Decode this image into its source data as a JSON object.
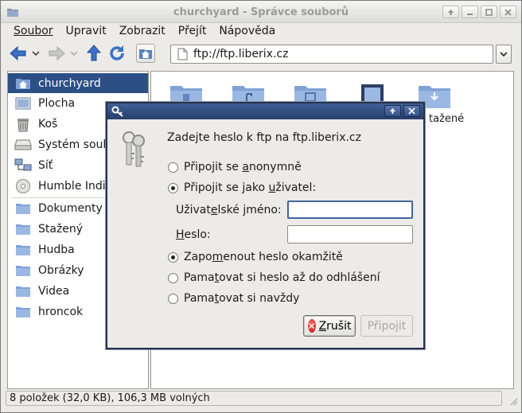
{
  "window": {
    "title": "churchyard - Správce souborů"
  },
  "menubar": {
    "items": [
      {
        "label": "Soubor"
      },
      {
        "label": "Upravit"
      },
      {
        "label": "Zobrazit"
      },
      {
        "label": "Přejít"
      },
      {
        "label": "Nápověda"
      }
    ]
  },
  "toolbar": {
    "address": "ftp://ftp.liberix.cz"
  },
  "sidebar": {
    "items": [
      {
        "label": "churchyard",
        "icon": "home-folder-icon",
        "selected": true
      },
      {
        "label": "Plocha",
        "icon": "desktop-icon"
      },
      {
        "label": "Koš",
        "icon": "trash-icon"
      },
      {
        "label": "Systém soubo",
        "icon": "harddisk-icon"
      },
      {
        "label": "Síť",
        "icon": "network-icon"
      },
      {
        "label": "Humble Indie",
        "icon": "optical-disc-icon"
      },
      {
        "label": "Dokumenty",
        "icon": "folder-icon"
      },
      {
        "label": "Stažený",
        "icon": "folder-icon"
      },
      {
        "label": "Hudba",
        "icon": "folder-icon"
      },
      {
        "label": "Obrázky",
        "icon": "folder-icon"
      },
      {
        "label": "Videa",
        "icon": "folder-icon"
      },
      {
        "label": "hroncok",
        "icon": "folder-icon"
      }
    ]
  },
  "mainview": {
    "visible_label": "tažené"
  },
  "statusbar": {
    "text": "8 položek (32,0 KB), 106,3 MB volných"
  },
  "dialog": {
    "prompt": "Zadejte heslo k ftp na ftp.liberix.cz",
    "opt_anonymous_pre": "Připojit se ",
    "opt_anonymous_key": "a",
    "opt_anonymous_post": "nonymně",
    "opt_user_pre": "Připojit se jako ",
    "opt_user_key": "u",
    "opt_user_post": "živatel:",
    "username_label_pre": "Uživat",
    "username_label_key": "e",
    "username_label_post": "lské jméno:",
    "username_value": "",
    "password_label_key": "H",
    "password_label_post": "eslo:",
    "password_value": "",
    "forget_pre": "Zapo",
    "forget_key": "m",
    "forget_post": "enout heslo okamžitě",
    "remember_session_pre": "Pama",
    "remember_session_key": "t",
    "remember_session_post": "ovat si heslo až do odhlášení",
    "remember_forever_pre": "Pama",
    "remember_forever_key": "t",
    "remember_forever_post": "ovat si navždy",
    "cancel_key": "Z",
    "cancel_post": "rušit",
    "connect_label": "Připojit",
    "login_mode": "user",
    "remember_mode": "forget"
  },
  "colors": {
    "selection": "#2d4f87",
    "dialog_title": "#2f4a7c",
    "cancel_icon": "#d42a20"
  }
}
